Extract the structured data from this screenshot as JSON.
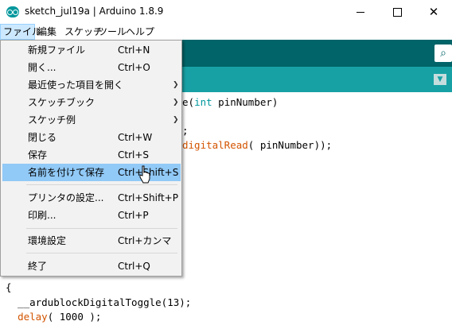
{
  "window": {
    "title": "sketch_jul19a | Arduino 1.8.9"
  },
  "menubar": [
    {
      "label": "ファイル",
      "active": true
    },
    {
      "label": "編集"
    },
    {
      "label": "スケッチ"
    },
    {
      "label": "ツール"
    },
    {
      "label": "ヘルプ"
    }
  ],
  "file_menu": {
    "items": [
      {
        "label": "新規ファイル",
        "shortcut": "Ctrl+N"
      },
      {
        "label": "開く...",
        "shortcut": "Ctrl+O"
      },
      {
        "label": "最近使った項目を開く",
        "shortcut": "",
        "submenu": true
      },
      {
        "label": "スケッチブック",
        "shortcut": "",
        "submenu": true
      },
      {
        "label": "スケッチ例",
        "shortcut": "",
        "submenu": true
      },
      {
        "label": "閉じる",
        "shortcut": "Ctrl+W"
      },
      {
        "label": "保存",
        "shortcut": "Ctrl+S"
      },
      {
        "label": "名前を付けて保存",
        "shortcut": "Ctrl+Shift+S",
        "highlighted": true
      },
      {
        "label": "プリンタの設定...",
        "shortcut": "Ctrl+Shift+P"
      },
      {
        "label": "印刷...",
        "shortcut": "Ctrl+P"
      },
      {
        "label": "環境設定",
        "shortcut": "Ctrl+カンマ"
      },
      {
        "label": "終了",
        "shortcut": "Ctrl+Q"
      }
    ]
  },
  "code": {
    "l1_tail": "e(",
    "l1_kw": "int",
    "l1_rest": " pinNumber)",
    "l2_tail": ";",
    "l3_fn": "digitalRead",
    "l3_rest": "( pinNumber));",
    "l4": "{",
    "l5": "  __ardublockDigitalToggle(13);",
    "l6_fn": "delay",
    "l6_rest": "( 1000 );"
  },
  "icons": {
    "serial": "serial-monitor-icon",
    "tab_menu": "tab-menu-icon"
  }
}
